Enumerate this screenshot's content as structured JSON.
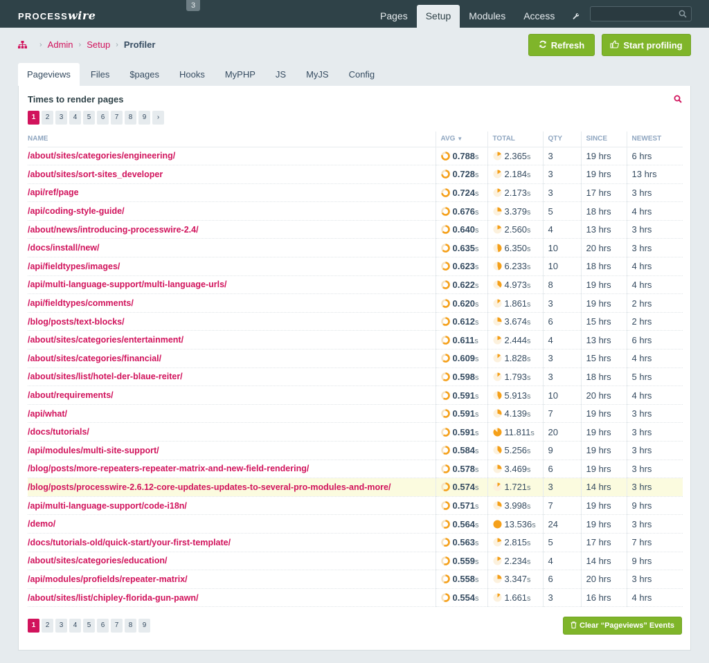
{
  "brand": {
    "name_prefix": "PROCESS",
    "name_suffix": "wire"
  },
  "notice_count": "3",
  "topnav": [
    {
      "label": "Pages",
      "active": false
    },
    {
      "label": "Setup",
      "active": true
    },
    {
      "label": "Modules",
      "active": false
    },
    {
      "label": "Access",
      "active": false
    }
  ],
  "search": {
    "value": ""
  },
  "breadcrumb": {
    "items": [
      "Admin",
      "Setup"
    ],
    "current": "Profiler"
  },
  "actions": {
    "refresh": "Refresh",
    "start": "Start profiling"
  },
  "tabs": [
    {
      "label": "Pageviews",
      "active": true
    },
    {
      "label": "Files",
      "active": false
    },
    {
      "label": "$pages",
      "active": false
    },
    {
      "label": "Hooks",
      "active": false
    },
    {
      "label": "MyPHP",
      "active": false
    },
    {
      "label": "JS",
      "active": false
    },
    {
      "label": "MyJS",
      "active": false
    },
    {
      "label": "Config",
      "active": false
    }
  ],
  "panel": {
    "title": "Times to render pages"
  },
  "pager": {
    "pages": [
      "1",
      "2",
      "3",
      "4",
      "5",
      "6",
      "7",
      "8",
      "9"
    ],
    "current": "1",
    "next": "›"
  },
  "table": {
    "headers": {
      "name": "NAME",
      "avg": "AVG",
      "total": "TOTAL",
      "qty": "QTY",
      "since": "SINCE",
      "newest": "NEWEST"
    },
    "unit": "s",
    "max_total": 13.536,
    "rows": [
      {
        "name": "/about/sites/categories/engineering/",
        "avg": "0.788",
        "total": "2.365",
        "qty": "3",
        "since": "19 hrs",
        "newest": "6 hrs"
      },
      {
        "name": "/about/sites/sort-sites_developer",
        "avg": "0.728",
        "total": "2.184",
        "qty": "3",
        "since": "19 hrs",
        "newest": "13 hrs"
      },
      {
        "name": "/api/ref/page",
        "avg": "0.724",
        "total": "2.173",
        "qty": "3",
        "since": "17 hrs",
        "newest": "3 hrs"
      },
      {
        "name": "/api/coding-style-guide/",
        "avg": "0.676",
        "total": "3.379",
        "qty": "5",
        "since": "18 hrs",
        "newest": "4 hrs"
      },
      {
        "name": "/about/news/introducing-processwire-2.4/",
        "avg": "0.640",
        "total": "2.560",
        "qty": "4",
        "since": "13 hrs",
        "newest": "3 hrs"
      },
      {
        "name": "/docs/install/new/",
        "avg": "0.635",
        "total": "6.350",
        "qty": "10",
        "since": "20 hrs",
        "newest": "3 hrs"
      },
      {
        "name": "/api/fieldtypes/images/",
        "avg": "0.623",
        "total": "6.233",
        "qty": "10",
        "since": "18 hrs",
        "newest": "4 hrs"
      },
      {
        "name": "/api/multi-language-support/multi-language-urls/",
        "avg": "0.622",
        "total": "4.973",
        "qty": "8",
        "since": "19 hrs",
        "newest": "4 hrs"
      },
      {
        "name": "/api/fieldtypes/comments/",
        "avg": "0.620",
        "total": "1.861",
        "qty": "3",
        "since": "19 hrs",
        "newest": "2 hrs"
      },
      {
        "name": "/blog/posts/text-blocks/",
        "avg": "0.612",
        "total": "3.674",
        "qty": "6",
        "since": "15 hrs",
        "newest": "2 hrs"
      },
      {
        "name": "/about/sites/categories/entertainment/",
        "avg": "0.611",
        "total": "2.444",
        "qty": "4",
        "since": "13 hrs",
        "newest": "6 hrs"
      },
      {
        "name": "/about/sites/categories/financial/",
        "avg": "0.609",
        "total": "1.828",
        "qty": "3",
        "since": "15 hrs",
        "newest": "4 hrs"
      },
      {
        "name": "/about/sites/list/hotel-der-blaue-reiter/",
        "avg": "0.598",
        "total": "1.793",
        "qty": "3",
        "since": "18 hrs",
        "newest": "5 hrs"
      },
      {
        "name": "/about/requirements/",
        "avg": "0.591",
        "total": "5.913",
        "qty": "10",
        "since": "20 hrs",
        "newest": "4 hrs"
      },
      {
        "name": "/api/what/",
        "avg": "0.591",
        "total": "4.139",
        "qty": "7",
        "since": "19 hrs",
        "newest": "3 hrs"
      },
      {
        "name": "/docs/tutorials/",
        "avg": "0.591",
        "total": "11.811",
        "qty": "20",
        "since": "19 hrs",
        "newest": "3 hrs"
      },
      {
        "name": "/api/modules/multi-site-support/",
        "avg": "0.584",
        "total": "5.256",
        "qty": "9",
        "since": "19 hrs",
        "newest": "3 hrs"
      },
      {
        "name": "/blog/posts/more-repeaters-repeater-matrix-and-new-field-rendering/",
        "avg": "0.578",
        "total": "3.469",
        "qty": "6",
        "since": "19 hrs",
        "newest": "3 hrs"
      },
      {
        "name": "/blog/posts/processwire-2.6.12-core-updates-updates-to-several-pro-modules-and-more/",
        "avg": "0.574",
        "total": "1.721",
        "qty": "3",
        "since": "14 hrs",
        "newest": "3 hrs",
        "highlight": true
      },
      {
        "name": "/api/multi-language-support/code-i18n/",
        "avg": "0.571",
        "total": "3.998",
        "qty": "7",
        "since": "19 hrs",
        "newest": "9 hrs"
      },
      {
        "name": "/demo/",
        "avg": "0.564",
        "total": "13.536",
        "qty": "24",
        "since": "19 hrs",
        "newest": "3 hrs"
      },
      {
        "name": "/docs/tutorials-old/quick-start/your-first-template/",
        "avg": "0.563",
        "total": "2.815",
        "qty": "5",
        "since": "17 hrs",
        "newest": "7 hrs"
      },
      {
        "name": "/about/sites/categories/education/",
        "avg": "0.559",
        "total": "2.234",
        "qty": "4",
        "since": "14 hrs",
        "newest": "9 hrs"
      },
      {
        "name": "/api/modules/profields/repeater-matrix/",
        "avg": "0.558",
        "total": "3.347",
        "qty": "6",
        "since": "20 hrs",
        "newest": "3 hrs"
      },
      {
        "name": "/about/sites/list/chipley-florida-gun-pawn/",
        "avg": "0.554",
        "total": "1.661",
        "qty": "3",
        "since": "16 hrs",
        "newest": "4 hrs"
      }
    ]
  },
  "clear_button": "Clear “Pageviews” Events",
  "colors": {
    "accent": "#d1135c",
    "green": "#7fb52a",
    "orange": "#f5a01a",
    "masthead": "#2f4248"
  }
}
